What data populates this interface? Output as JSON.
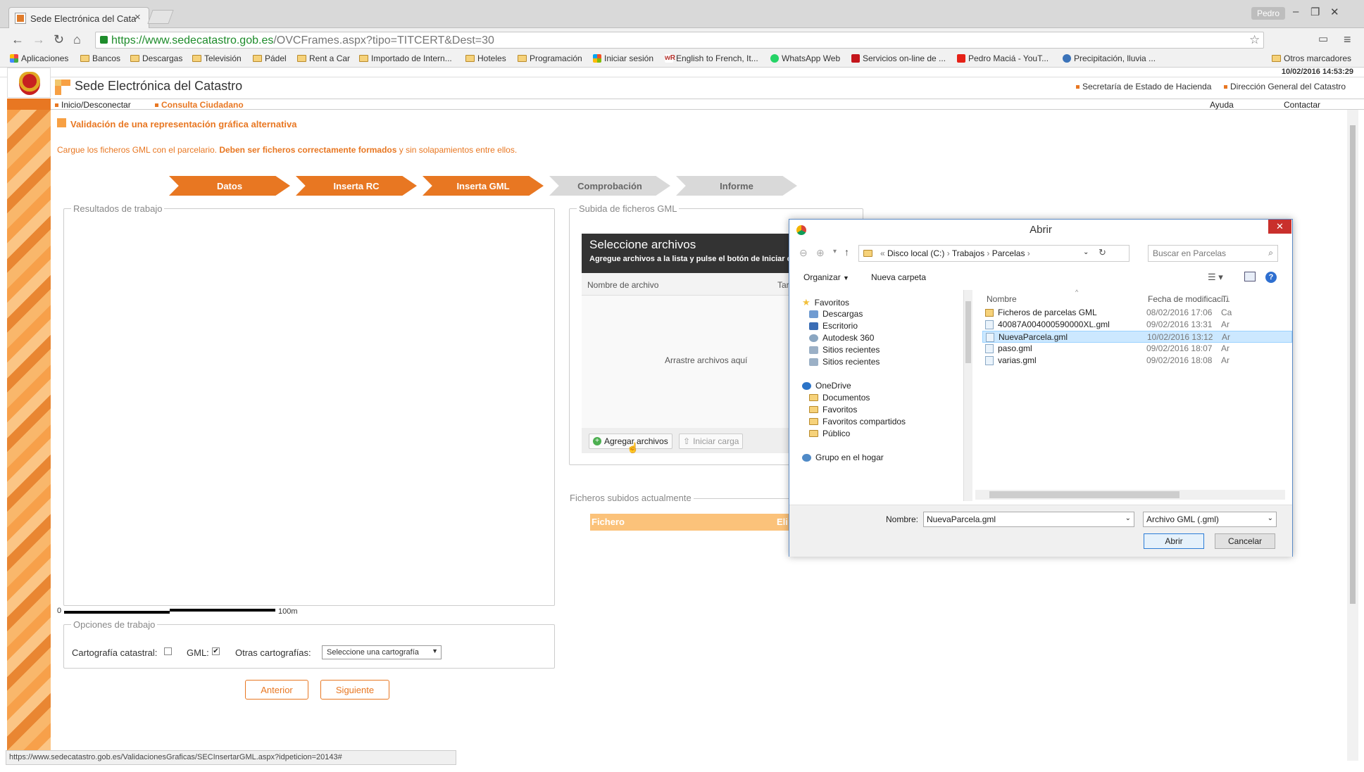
{
  "browser": {
    "tab_title": "Sede Electrónica del Catas",
    "user": "Pedro",
    "url_secure": "https://www.sedecatastro.gob.es",
    "url_rest": "/OVCFrames.aspx?tipo=TITCERT&Dest=30",
    "bookmarks": [
      "Aplicaciones",
      "Bancos",
      "Descargas",
      "Televisión",
      "Pádel",
      "Rent a Car",
      "Importado de Intern...",
      "Hoteles",
      "Programación",
      "Iniciar sesión",
      "English to French, It...",
      "WhatsApp Web",
      "Servicios on-line de ...",
      "Pedro Maciá - YouT...",
      "Precipitación, lluvia ...",
      "Otros marcadores"
    ],
    "status_url": "https://www.sedecatastro.gob.es/ValidacionesGraficas/SECInsertarGML.aspx?idpeticion=20143#"
  },
  "site": {
    "datetime": "10/02/2016 14:53:29",
    "title": "Sede Electrónica del Catastro",
    "top_links": [
      "Secretaría de Estado de Hacienda",
      "Dirección General del Catastro"
    ],
    "nav_left": [
      "Inicio/Desconectar",
      "Consulta Ciudadano"
    ],
    "nav_right": [
      "Ayuda",
      "Contactar"
    ]
  },
  "main": {
    "heading": "Validación de una representación gráfica alternativa",
    "intro_a": "Cargue los ficheros GML con el parcelario. ",
    "intro_b": "Deben ser ficheros correctamente formados",
    "intro_c": " y sin solapamientos entre ellos.",
    "steps": [
      {
        "label": "Datos",
        "active": true
      },
      {
        "label": "Inserta RC",
        "active": true
      },
      {
        "label": "Inserta GML",
        "active": true
      },
      {
        "label": "Comprobación",
        "active": false
      },
      {
        "label": "Informe",
        "active": false
      }
    ],
    "results_legend": "Resultados de trabajo",
    "scale_start": "0",
    "scale_end": "100m",
    "options_legend": "Opciones de trabajo",
    "cartografia_label": "Cartografía catastral:",
    "cartografia_checked": false,
    "gml_label": "GML:",
    "gml_checked": true,
    "otras_label": "Otras cartografías:",
    "otras_select": "Seleccione una cartografía",
    "prev_button": "Anterior",
    "next_button": "Siguiente",
    "upload_legend": "Subida de ficheros GML",
    "uploader_title": "Seleccione archivos",
    "uploader_sub": "Agregue archivos a la lista y pulse el botón de Iniciar carga",
    "col_name": "Nombre de archivo",
    "col_size": "Tar",
    "drop_text": "Arrastre archivos aquí",
    "add_files": "Agregar archivos",
    "start_upload": "Iniciar carga",
    "uploaded_legend": "Ficheros subidos actualmente",
    "fichero_col": "Fichero",
    "elim_col": "Eli"
  },
  "dialog": {
    "title": "Abrir",
    "breadcrumb": [
      "Disco local (C:)",
      "Trabajos",
      "Parcelas"
    ],
    "search_placeholder": "Buscar en Parcelas",
    "organize": "Organizar",
    "new_folder": "Nueva carpeta",
    "nav_items": [
      {
        "label": "Favoritos",
        "indent": 0,
        "color": "#f2c03b"
      },
      {
        "label": "Descargas",
        "indent": 1,
        "color": "#6f9bd1"
      },
      {
        "label": "Escritorio",
        "indent": 1,
        "color": "#3a6db5"
      },
      {
        "label": "Autodesk 360",
        "indent": 1,
        "color": "#8aa6c1"
      },
      {
        "label": "Sitios recientes",
        "indent": 1,
        "color": "#9bb0c6"
      },
      {
        "label": "Sitios recientes",
        "indent": 1,
        "color": "#9bb0c6"
      },
      {
        "label": "",
        "indent": 0,
        "color": ""
      },
      {
        "label": "OneDrive",
        "indent": 0,
        "color": "#2b74c8"
      },
      {
        "label": "Documentos",
        "indent": 1,
        "color": "#f6d27a"
      },
      {
        "label": "Favoritos",
        "indent": 1,
        "color": "#f6d27a"
      },
      {
        "label": "Favoritos compartidos",
        "indent": 1,
        "color": "#f6d27a"
      },
      {
        "label": "Público",
        "indent": 1,
        "color": "#f6d27a"
      },
      {
        "label": "",
        "indent": 0,
        "color": ""
      },
      {
        "label": "Grupo en el hogar",
        "indent": 0,
        "color": "#4f8ac7"
      }
    ],
    "columns": [
      "Nombre",
      "Fecha de modificaci...",
      "Ti"
    ],
    "files": [
      {
        "name": "Ficheros de parcelas GML",
        "date": "08/02/2016 17:06",
        "type": "Ca",
        "folder": true,
        "selected": false
      },
      {
        "name": "40087A004000590000XL.gml",
        "date": "09/02/2016 13:31",
        "type": "Ar",
        "folder": false,
        "selected": false
      },
      {
        "name": "NuevaParcela.gml",
        "date": "10/02/2016 13:12",
        "type": "Ar",
        "folder": false,
        "selected": true
      },
      {
        "name": "paso.gml",
        "date": "09/02/2016 18:07",
        "type": "Ar",
        "folder": false,
        "selected": false
      },
      {
        "name": "varias.gml",
        "date": "09/02/2016 18:08",
        "type": "Ar",
        "folder": false,
        "selected": false
      }
    ],
    "name_label": "Nombre:",
    "name_value": "NuevaParcela.gml",
    "filter_value": "Archivo GML (.gml)",
    "open_button": "Abrir",
    "cancel_button": "Cancelar"
  }
}
